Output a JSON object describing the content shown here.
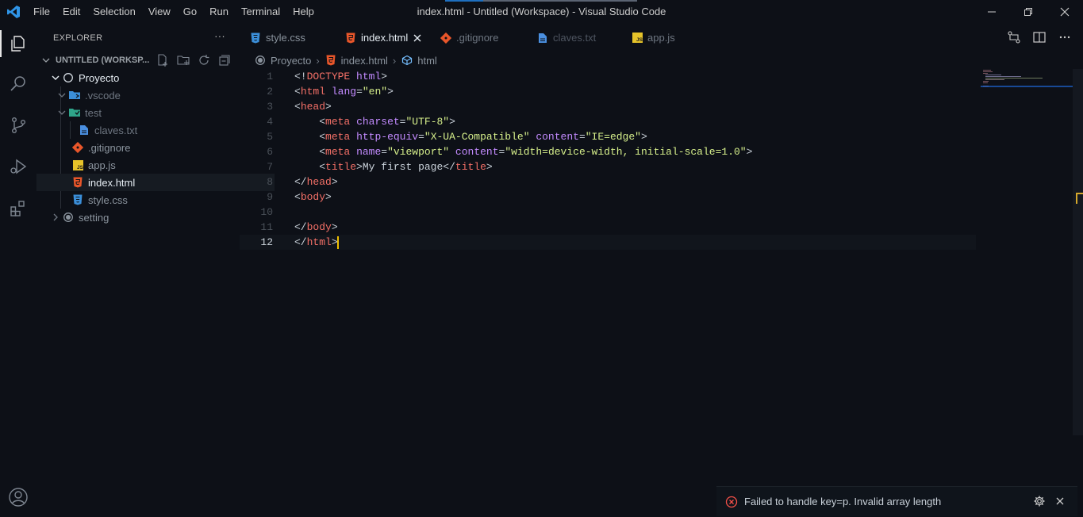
{
  "window": {
    "title": "index.html - Untitled (Workspace) - Visual Studio Code",
    "menu": [
      "File",
      "Edit",
      "Selection",
      "View",
      "Go",
      "Run",
      "Terminal",
      "Help"
    ]
  },
  "activity_bar": {
    "items": [
      "explorer-icon",
      "search-icon",
      "source-control-icon",
      "run-debug-icon",
      "extensions-icon"
    ],
    "bottom": [
      "account-icon"
    ]
  },
  "sidebar": {
    "header": "EXPLORER",
    "more": "···",
    "workspace_title": "UNTITLED (WORKSP...",
    "tree": [
      {
        "label": "Proyecto",
        "icon": "folder-root-icon",
        "color": "#e6edf3"
      },
      {
        "label": ".vscode",
        "icon": "folder-vscode-icon",
        "color": "#6e7681"
      },
      {
        "label": "test",
        "icon": "folder-test-icon",
        "color": "#6e7681"
      },
      {
        "label": "claves.txt",
        "icon": "text-file-icon",
        "color": "#6e7681"
      },
      {
        "label": ".gitignore",
        "icon": "git-icon",
        "color": "#8b949e"
      },
      {
        "label": "app.js",
        "icon": "js-file-icon",
        "color": "#8b949e"
      },
      {
        "label": "index.html",
        "icon": "html-file-icon",
        "color": "#e6edf3"
      },
      {
        "label": "style.css",
        "icon": "css-file-icon",
        "color": "#8b949e"
      },
      {
        "label": "setting",
        "icon": "folder-root-icon",
        "color": "#8b949e"
      }
    ]
  },
  "tabs": [
    {
      "label": "style.css",
      "icon": "css-file-icon",
      "active": false
    },
    {
      "label": "index.html",
      "icon": "html-file-icon",
      "active": true
    },
    {
      "label": ".gitignore",
      "icon": "git-icon",
      "active": false
    },
    {
      "label": "claves.txt",
      "icon": "text-file-icon",
      "active": false
    },
    {
      "label": "app.js",
      "icon": "js-file-icon",
      "active": false
    }
  ],
  "breadcrumb": [
    "Proyecto",
    "index.html",
    "html"
  ],
  "editor": {
    "current_line": 12,
    "line_numbers": [
      "1",
      "2",
      "3",
      "4",
      "5",
      "6",
      "7",
      "8",
      "9",
      "10",
      "11",
      "12"
    ]
  },
  "notification": {
    "message": "Failed to handle key=p. Invalid array length"
  },
  "colors": {
    "background": "#0d1017",
    "accent": "#1e6fbf",
    "error": "#f85149",
    "tag": "#f47067",
    "attribute": "#c38bff",
    "string": "#a5d6ff"
  }
}
